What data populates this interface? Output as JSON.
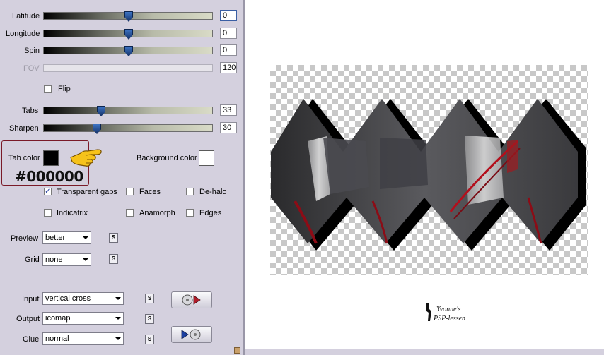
{
  "sliders": [
    {
      "key": "latitude",
      "label": "Latitude",
      "value": "0",
      "thumb": 0.5,
      "focused": true,
      "disabled": false
    },
    {
      "key": "longitude",
      "label": "Longitude",
      "value": "0",
      "thumb": 0.5,
      "focused": false,
      "disabled": false
    },
    {
      "key": "spin",
      "label": "Spin",
      "value": "0",
      "thumb": 0.5,
      "focused": false,
      "disabled": false
    },
    {
      "key": "fov",
      "label": "FOV",
      "value": "120",
      "thumb": null,
      "focused": false,
      "disabled": true
    },
    {
      "key": "tabs",
      "label": "Tabs",
      "value": "33",
      "thumb": 0.33,
      "focused": false,
      "disabled": false
    },
    {
      "key": "sharpen",
      "label": "Sharpen",
      "value": "30",
      "thumb": 0.3,
      "focused": false,
      "disabled": false
    }
  ],
  "flip": {
    "label": "Flip",
    "checked": false
  },
  "tab_color": {
    "label": "Tab color",
    "hex": "#000000",
    "color": "#000000"
  },
  "background_color": {
    "label": "Background color",
    "color": "#ffffff"
  },
  "options": {
    "transparent_gaps": {
      "label": "Transparent gaps",
      "checked": true
    },
    "faces": {
      "label": "Faces",
      "checked": false
    },
    "de_halo": {
      "label": "De-halo",
      "checked": false
    },
    "indicatrix": {
      "label": "Indicatrix",
      "checked": false
    },
    "anamorph": {
      "label": "Anamorph",
      "checked": false
    },
    "edges": {
      "label": "Edges",
      "checked": false
    }
  },
  "preview": {
    "label": "Preview",
    "value": "better"
  },
  "grid": {
    "label": "Grid",
    "value": "none"
  },
  "input": {
    "label": "Input",
    "value": "vertical cross"
  },
  "output": {
    "label": "Output",
    "value": "icomap"
  },
  "glue": {
    "label": "Glue",
    "value": "normal"
  },
  "icons": {
    "s_button": "S",
    "play_left": "disc-play-icon",
    "play_right": "play-disc-icon"
  },
  "watermark": {
    "line1": "Yvonne's",
    "line2": "PSP-lessen"
  }
}
